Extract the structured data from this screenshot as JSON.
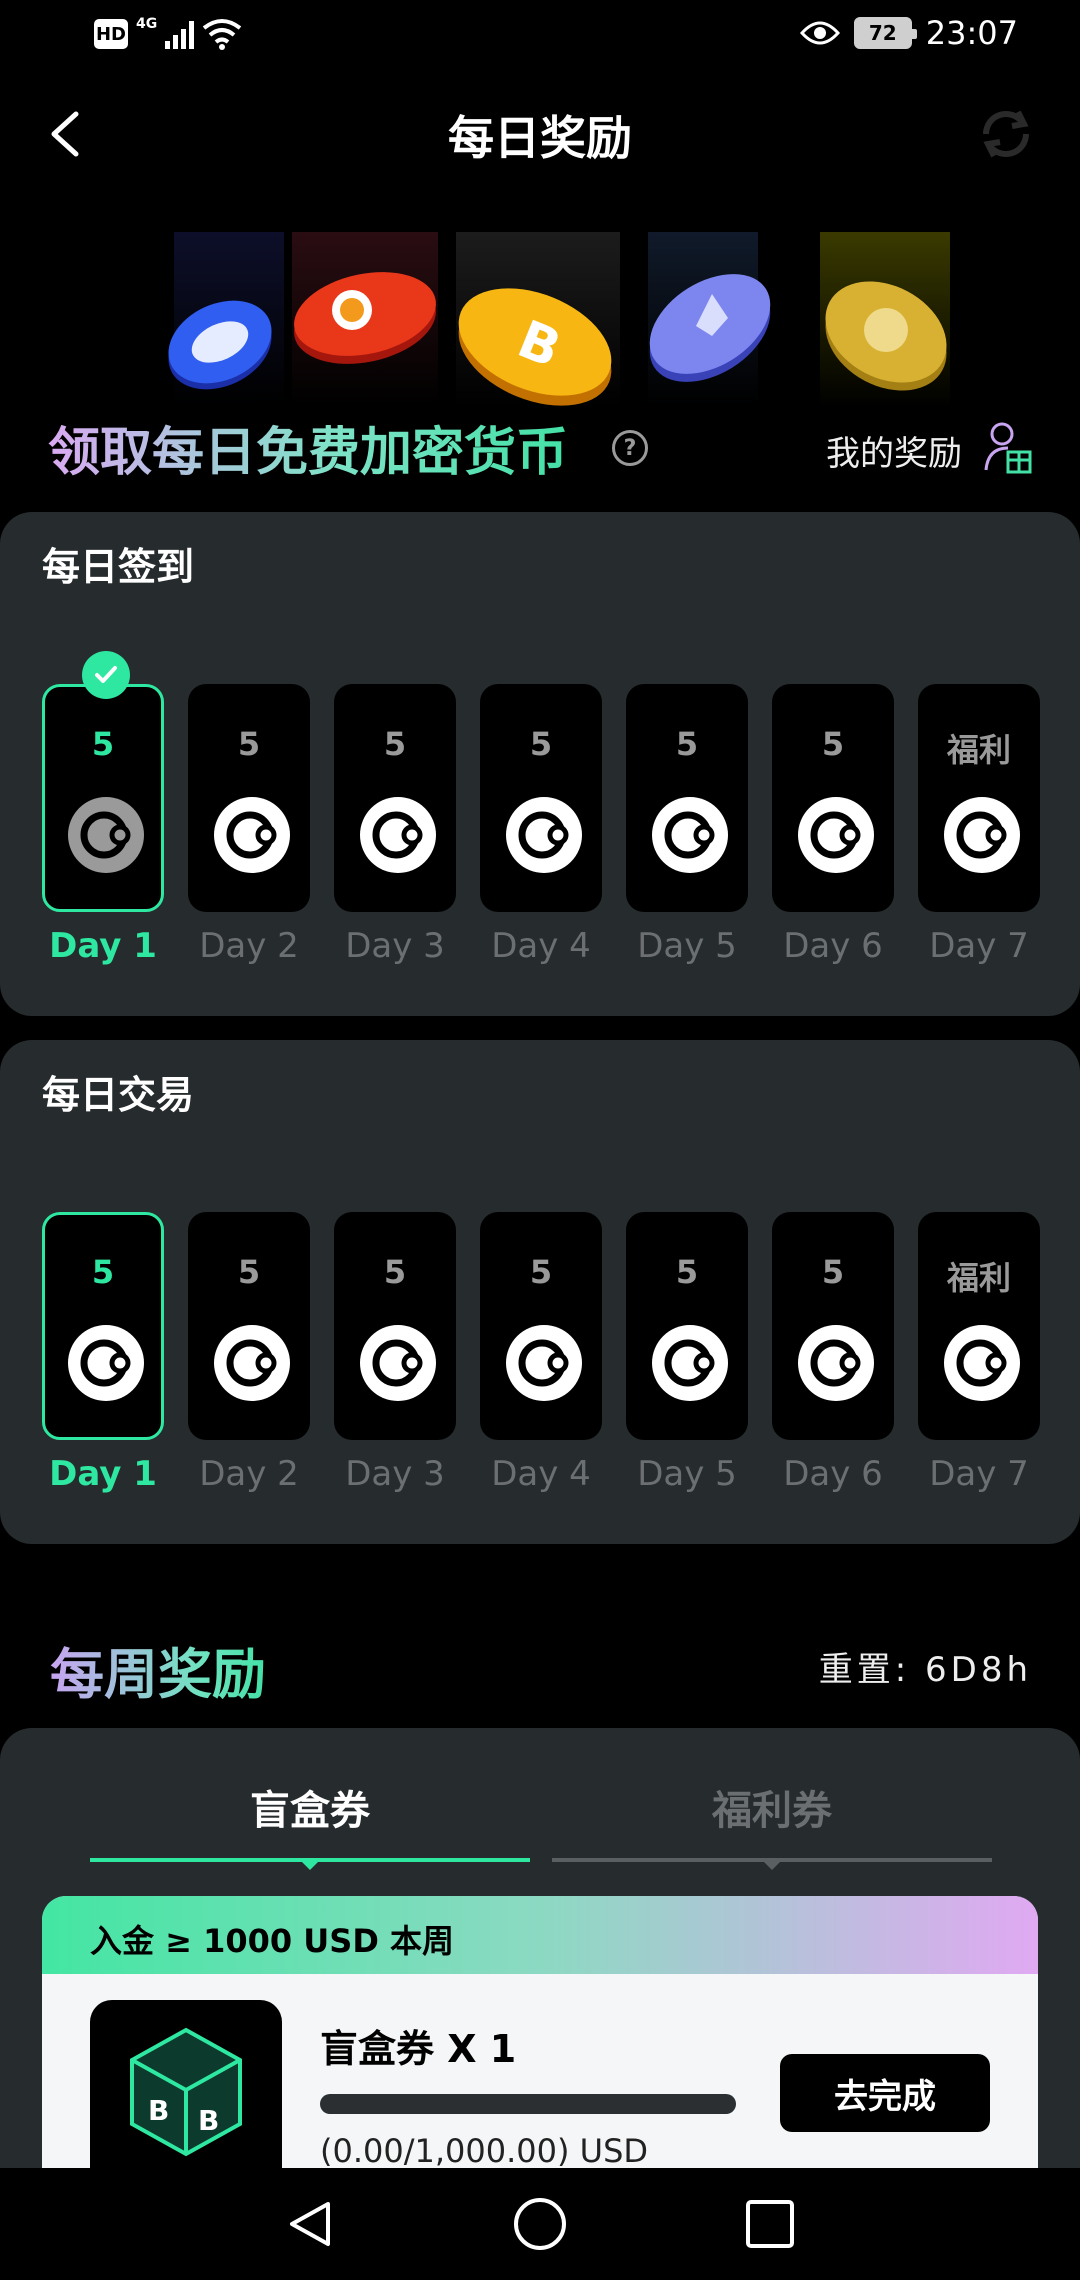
{
  "status_bar": {
    "hd": "HD",
    "network": "4G",
    "battery": "72",
    "time": "23:07",
    "icons": [
      "hd-icon",
      "signal-icon",
      "wifi-icon",
      "eye-icon",
      "battery-icon"
    ]
  },
  "nav": {
    "title": "每日奖励"
  },
  "banner": {
    "coins": [
      "bnb-coin",
      "shiba-coin",
      "bitcoin-coin",
      "ethereum-coin",
      "doge-coin"
    ],
    "headline": "领取每日免费加密货币",
    "my_rewards_label": "我的奖励"
  },
  "daily_checkin": {
    "title": "每日签到",
    "days": [
      {
        "value": "5",
        "label": "Day 1",
        "active": true,
        "checked": true
      },
      {
        "value": "5",
        "label": "Day 2",
        "active": false,
        "checked": false
      },
      {
        "value": "5",
        "label": "Day 3",
        "active": false,
        "checked": false
      },
      {
        "value": "5",
        "label": "Day 4",
        "active": false,
        "checked": false
      },
      {
        "value": "5",
        "label": "Day 5",
        "active": false,
        "checked": false
      },
      {
        "value": "5",
        "label": "Day 6",
        "active": false,
        "checked": false
      },
      {
        "value": "福利",
        "label": "Day 7",
        "active": false,
        "checked": false
      }
    ]
  },
  "daily_trade": {
    "title": "每日交易",
    "days": [
      {
        "value": "5",
        "label": "Day 1",
        "active": true
      },
      {
        "value": "5",
        "label": "Day 2",
        "active": false
      },
      {
        "value": "5",
        "label": "Day 3",
        "active": false
      },
      {
        "value": "5",
        "label": "Day 4",
        "active": false
      },
      {
        "value": "5",
        "label": "Day 5",
        "active": false
      },
      {
        "value": "5",
        "label": "Day 6",
        "active": false
      },
      {
        "value": "福利",
        "label": "Day 7",
        "active": false
      }
    ]
  },
  "weekly": {
    "title": "每周奖励",
    "reset_label": "重置:",
    "reset_value": "6D8h",
    "tabs": [
      {
        "label": "盲盒券",
        "active": true
      },
      {
        "label": "福利券",
        "active": false
      }
    ],
    "task": {
      "header": "入金 ≥ 1000 USD 本周",
      "name": "盲盒券 X 1",
      "progress_fraction": 0,
      "progress_text": "(0.00/1,000.00) USD",
      "button": "去完成"
    }
  },
  "colors": {
    "accent": "#2ee8a1",
    "card_bg": "#262b2e",
    "tile_bg": "#000000",
    "muted": "#6b6f72"
  }
}
